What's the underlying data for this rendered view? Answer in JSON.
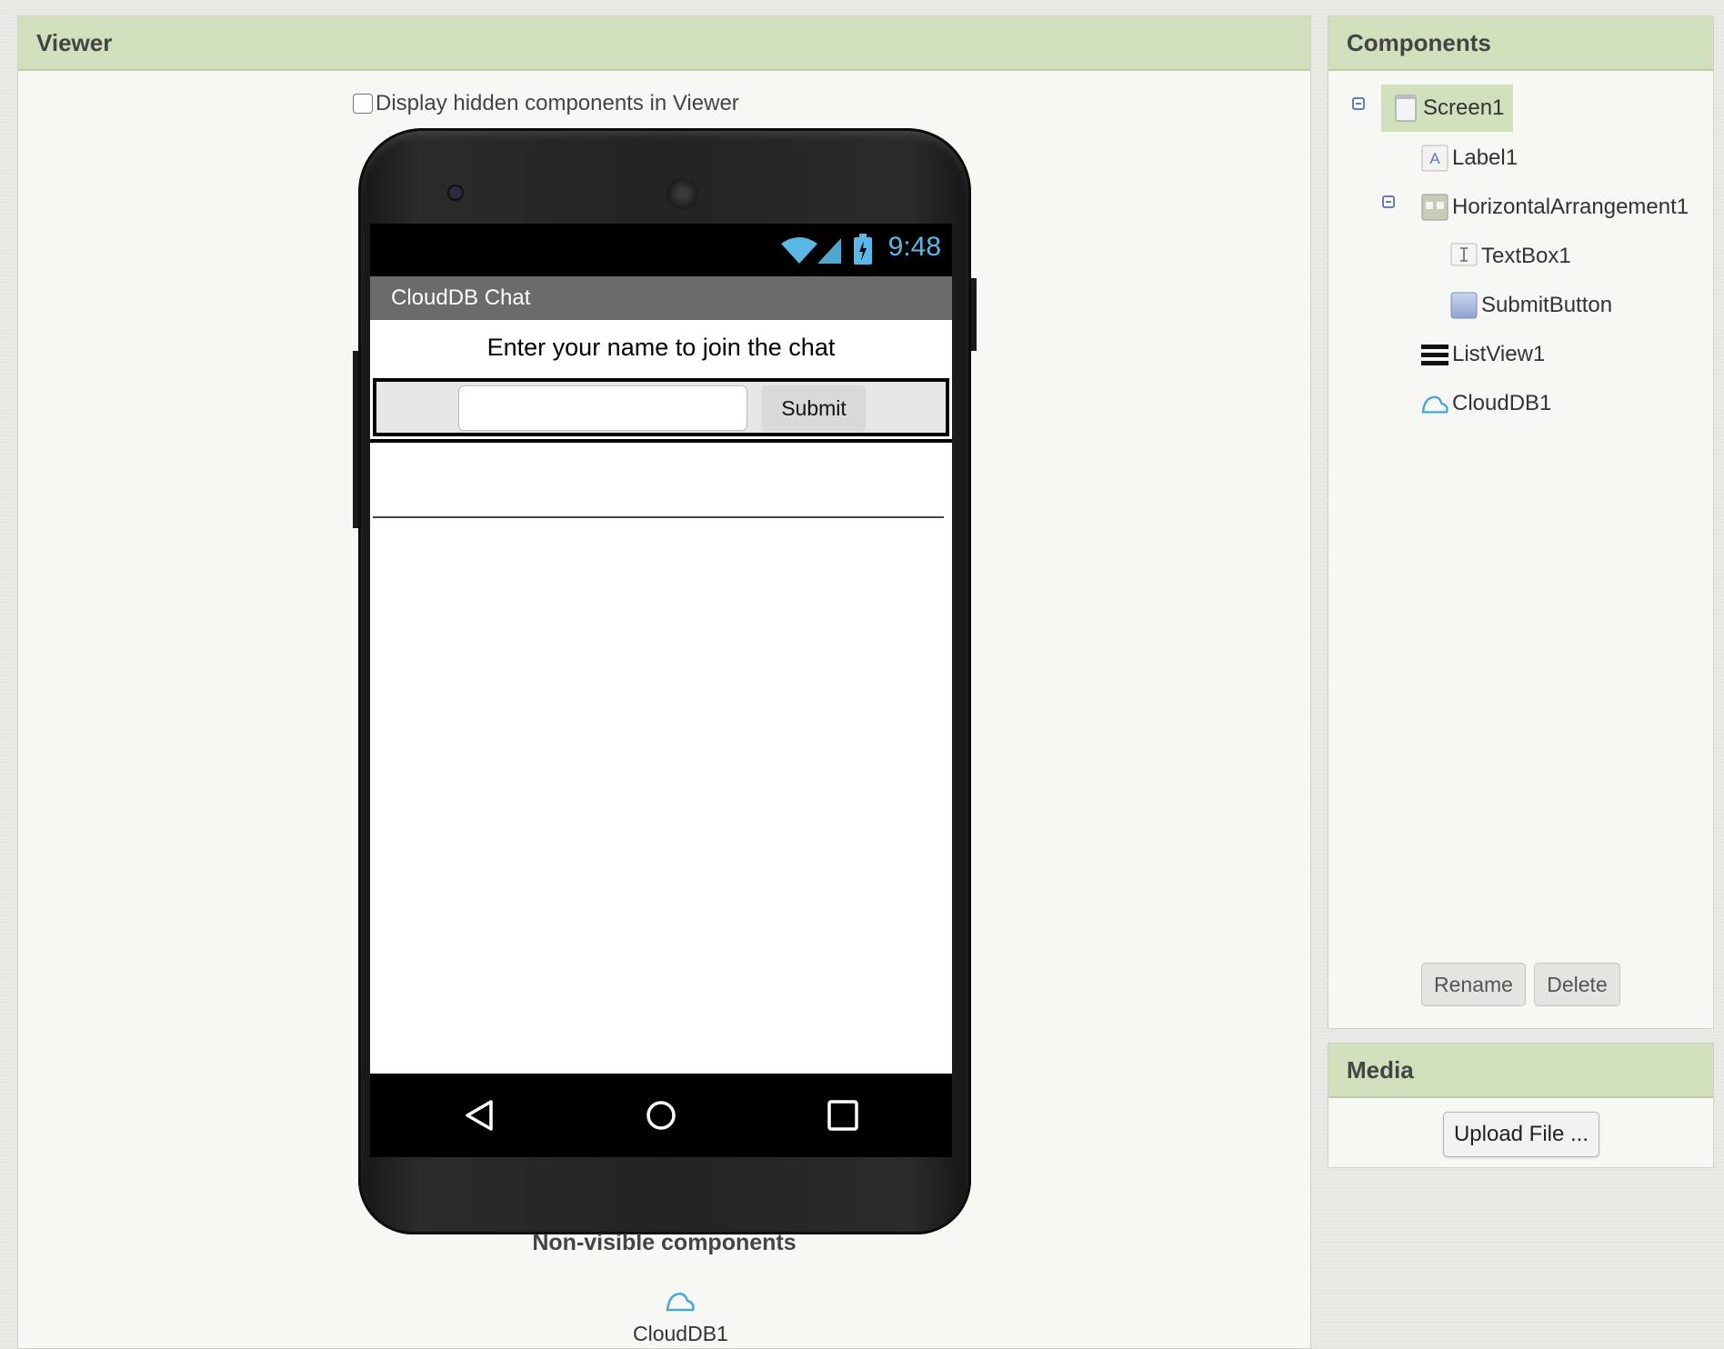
{
  "viewer": {
    "title": "Viewer",
    "display_hidden_label": "Display hidden components in Viewer",
    "phone": {
      "time": "9:48",
      "app_title": "CloudDB Chat",
      "label_text": "Enter your name to join the chat",
      "textbox_value": "",
      "submit_label": "Submit"
    },
    "nonvisible_title": "Non-visible components",
    "nonvisible_items": [
      {
        "label": "CloudDB1",
        "icon": "cloud-icon"
      }
    ]
  },
  "components": {
    "title": "Components",
    "tree": [
      {
        "label": "Screen1",
        "icon": "screen-icon",
        "selected": true
      },
      {
        "label": "Label1",
        "icon": "label-icon"
      },
      {
        "label": "HorizontalArrangement1",
        "icon": "horizontal-arrangement-icon"
      },
      {
        "label": "TextBox1",
        "icon": "textbox-icon"
      },
      {
        "label": "SubmitButton",
        "icon": "button-icon"
      },
      {
        "label": "ListView1",
        "icon": "listview-icon"
      },
      {
        "label": "CloudDB1",
        "icon": "cloud-icon"
      }
    ],
    "rename_label": "Rename",
    "delete_label": "Delete"
  },
  "media": {
    "title": "Media",
    "upload_label": "Upload File ..."
  },
  "colors": {
    "header_bg": "#d2dfbc",
    "panel_bg": "#f7f8f3",
    "clock": "#5ab8e6"
  }
}
